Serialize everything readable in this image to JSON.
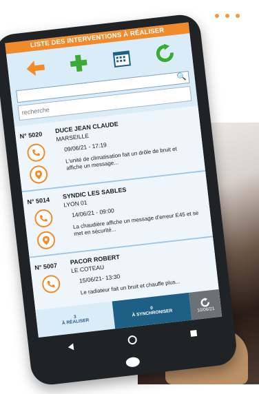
{
  "header": {
    "title": "LISTE DES INTERVENTIONS À RÉALISER"
  },
  "search": {
    "placeholder": "recherche"
  },
  "interventions": [
    {
      "num": "N° 5020",
      "name": "DUCE JEAN CLAUDE",
      "city": "MARSEILLE",
      "date": "09/06/21 - 17:19",
      "message": "L'unité de climatisation fait un drôle de bruit et affiche un message..."
    },
    {
      "num": "N° 5014",
      "name": "SYNDIC LES SABLES",
      "city": "LYON 01",
      "date": "14/06/21 - 09:00",
      "message": "La chaudière affiche un message d'erreur E45 et se met en sécurité..."
    },
    {
      "num": "N° 5007",
      "name": "PACOR ROBERT",
      "city": "LE COTEAU",
      "date": "15/06/21- 13:30",
      "message": "Le radiateur fait un bruit et chauffe plus..."
    }
  ],
  "tabs": {
    "realiser_count": "3",
    "realiser_label": "À RÉALISER",
    "sync_count": "0",
    "sync_label": "À SYNCHRONISER",
    "last_sync": "10/06/21"
  },
  "colors": {
    "orange": "#f08a2a",
    "green": "#3aa935",
    "blue": "#1e5f86",
    "light": "#d9ecf7"
  }
}
